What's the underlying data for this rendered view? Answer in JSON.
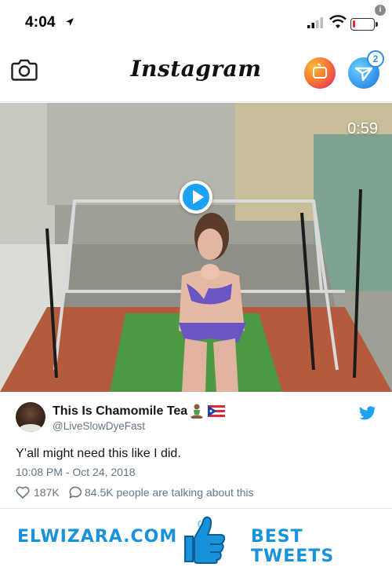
{
  "status_bar": {
    "time": "4:04",
    "info_badge": "i",
    "battery_level": 0.12,
    "accent_color": "#e8263a"
  },
  "instagram_header": {
    "logo_text": "Instagram",
    "dm_badge_count": "2",
    "icons": [
      "camera-icon",
      "igtv-icon",
      "direct-message-icon"
    ]
  },
  "video": {
    "duration": "0:59",
    "play_icon": "play-icon",
    "accent_color": "#1da1f2"
  },
  "tweet": {
    "display_name": "This Is Chamomile Tea",
    "handle": "@LiveSlowDyeFast",
    "text": "Y’all might need this like I did.",
    "timestamp": "10:08 PM - Oct 24, 2018",
    "likes": "187K",
    "talking": "84.5K people are talking about this",
    "brand_color": "#1da1f2"
  },
  "branding": {
    "left_text": "ELWIZARA.COM",
    "right_text": "BEST TWEETS",
    "color": "#1992dc"
  }
}
